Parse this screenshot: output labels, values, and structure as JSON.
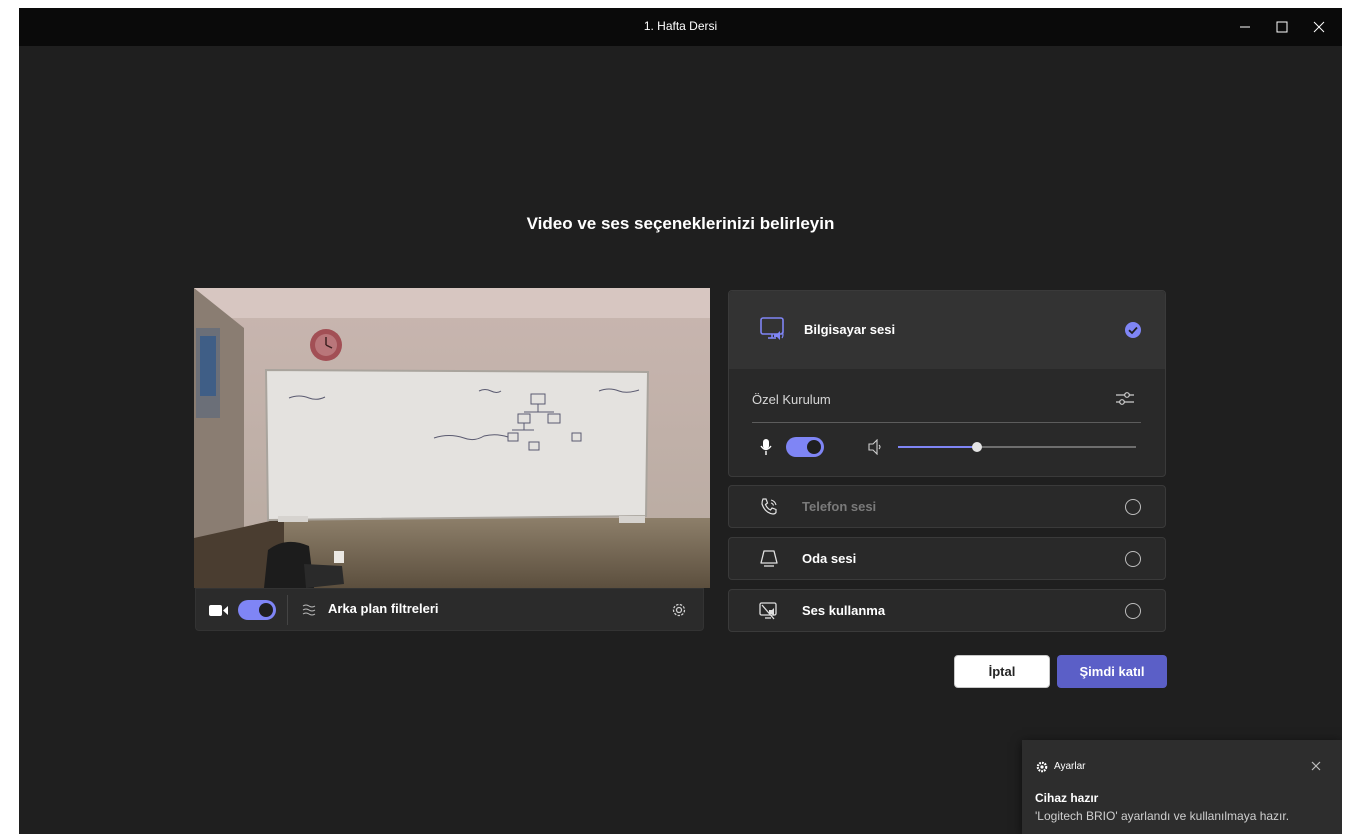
{
  "window": {
    "title": "1. Hafta Dersi",
    "controls": [
      "minimize-icon",
      "maximize-icon",
      "close-icon"
    ]
  },
  "heading": "Video ve ses seçeneklerinizi belirleyin",
  "video": {
    "camera_toggle_on": true,
    "background_filters_label": "Arka plan filtreleri",
    "settings_icon": "gear-icon"
  },
  "audio": {
    "computer": {
      "label": "Bilgisayar sesi",
      "selected": true,
      "custom_setup_label": "Özel Kurulum",
      "mic_toggle_on": true,
      "speaker_volume": 0.33
    },
    "options": [
      {
        "label": "Telefon sesi",
        "icon": "phone-icon",
        "disabled": true
      },
      {
        "label": "Oda sesi",
        "icon": "room-device-icon",
        "disabled": false
      },
      {
        "label": "Ses kullanma",
        "icon": "no-audio-icon",
        "disabled": false
      }
    ]
  },
  "buttons": {
    "cancel": "İptal",
    "join": "Şimdi katıl"
  },
  "toast": {
    "header": "Ayarlar",
    "title": "Cihaz hazır",
    "message": "'Logitech BRIO' ayarlandı ve kullanılmaya hazır."
  },
  "colors": {
    "accent": "#7f85f5",
    "primary_button": "#5b5fc7",
    "background": "#1f1f1f"
  }
}
